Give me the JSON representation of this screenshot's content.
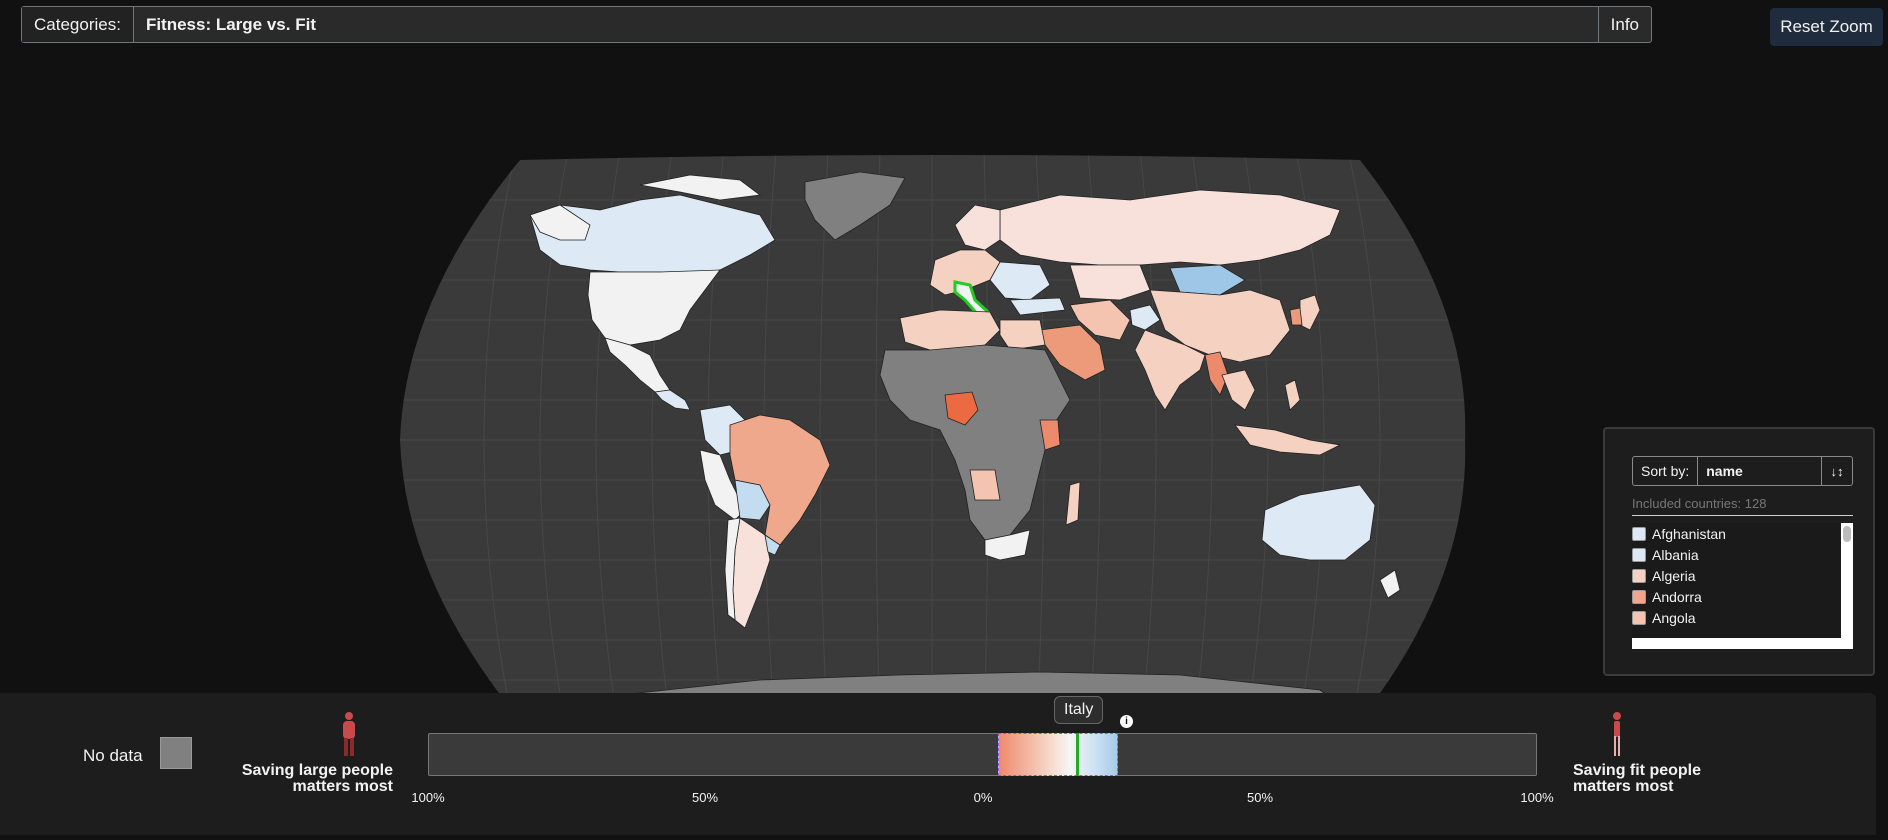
{
  "header": {
    "categories_label": "Categories:",
    "category_value": "Fitness: Large vs. Fit",
    "info_label": "Info",
    "reset_zoom_label": "Reset Zoom"
  },
  "map": {
    "highlighted_country": "Italy",
    "colors": {
      "no_data": "#808080",
      "ocean": "#3a3a3a",
      "background": "#111111",
      "large_strong": "#ee7b57",
      "large_light": "#f5d1c2",
      "neutral": "#f2f2f2",
      "fit_light": "#dde9f4",
      "fit_strong": "#9ec6e6",
      "selected_outline": "#22cc22"
    }
  },
  "sort_panel": {
    "sort_label": "Sort by:",
    "sort_value": "name",
    "sort_direction_icon": "↓↕",
    "included_text": "Included countries: 128",
    "countries": [
      {
        "name": "Afghanistan",
        "color": "#dde9f4"
      },
      {
        "name": "Albania",
        "color": "#dde9f4"
      },
      {
        "name": "Algeria",
        "color": "#f5d1c2"
      },
      {
        "name": "Andorra",
        "color": "#f2a58b"
      },
      {
        "name": "Angola",
        "color": "#f5c4b1"
      }
    ]
  },
  "legend": {
    "no_data_label": "No data",
    "left_label_line1": "Saving large people",
    "left_label_line2": "matters most",
    "right_label_line1": "Saving fit people",
    "right_label_line2": "matters most",
    "tooltip": "Italy",
    "info_icon_text": "i",
    "ticks": [
      "100%",
      "50%",
      "0%",
      "50%",
      "100%"
    ]
  }
}
